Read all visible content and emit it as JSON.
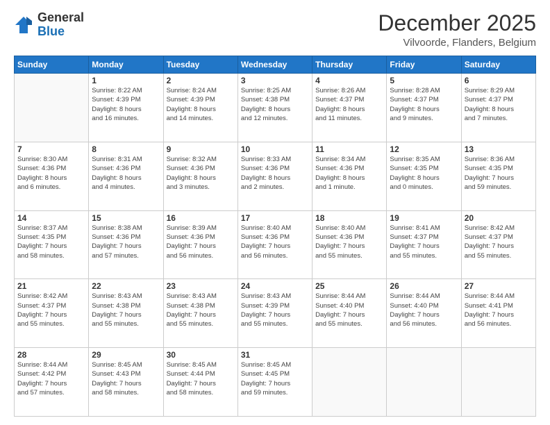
{
  "header": {
    "logo": {
      "line1": "General",
      "line2": "Blue"
    },
    "title": "December 2025",
    "location": "Vilvoorde, Flanders, Belgium"
  },
  "weekdays": [
    "Sunday",
    "Monday",
    "Tuesday",
    "Wednesday",
    "Thursday",
    "Friday",
    "Saturday"
  ],
  "weeks": [
    [
      {
        "day": "",
        "info": ""
      },
      {
        "day": "1",
        "info": "Sunrise: 8:22 AM\nSunset: 4:39 PM\nDaylight: 8 hours\nand 16 minutes."
      },
      {
        "day": "2",
        "info": "Sunrise: 8:24 AM\nSunset: 4:39 PM\nDaylight: 8 hours\nand 14 minutes."
      },
      {
        "day": "3",
        "info": "Sunrise: 8:25 AM\nSunset: 4:38 PM\nDaylight: 8 hours\nand 12 minutes."
      },
      {
        "day": "4",
        "info": "Sunrise: 8:26 AM\nSunset: 4:37 PM\nDaylight: 8 hours\nand 11 minutes."
      },
      {
        "day": "5",
        "info": "Sunrise: 8:28 AM\nSunset: 4:37 PM\nDaylight: 8 hours\nand 9 minutes."
      },
      {
        "day": "6",
        "info": "Sunrise: 8:29 AM\nSunset: 4:37 PM\nDaylight: 8 hours\nand 7 minutes."
      }
    ],
    [
      {
        "day": "7",
        "info": "Sunrise: 8:30 AM\nSunset: 4:36 PM\nDaylight: 8 hours\nand 6 minutes."
      },
      {
        "day": "8",
        "info": "Sunrise: 8:31 AM\nSunset: 4:36 PM\nDaylight: 8 hours\nand 4 minutes."
      },
      {
        "day": "9",
        "info": "Sunrise: 8:32 AM\nSunset: 4:36 PM\nDaylight: 8 hours\nand 3 minutes."
      },
      {
        "day": "10",
        "info": "Sunrise: 8:33 AM\nSunset: 4:36 PM\nDaylight: 8 hours\nand 2 minutes."
      },
      {
        "day": "11",
        "info": "Sunrise: 8:34 AM\nSunset: 4:36 PM\nDaylight: 8 hours\nand 1 minute."
      },
      {
        "day": "12",
        "info": "Sunrise: 8:35 AM\nSunset: 4:35 PM\nDaylight: 8 hours\nand 0 minutes."
      },
      {
        "day": "13",
        "info": "Sunrise: 8:36 AM\nSunset: 4:35 PM\nDaylight: 7 hours\nand 59 minutes."
      }
    ],
    [
      {
        "day": "14",
        "info": "Sunrise: 8:37 AM\nSunset: 4:35 PM\nDaylight: 7 hours\nand 58 minutes."
      },
      {
        "day": "15",
        "info": "Sunrise: 8:38 AM\nSunset: 4:36 PM\nDaylight: 7 hours\nand 57 minutes."
      },
      {
        "day": "16",
        "info": "Sunrise: 8:39 AM\nSunset: 4:36 PM\nDaylight: 7 hours\nand 56 minutes."
      },
      {
        "day": "17",
        "info": "Sunrise: 8:40 AM\nSunset: 4:36 PM\nDaylight: 7 hours\nand 56 minutes."
      },
      {
        "day": "18",
        "info": "Sunrise: 8:40 AM\nSunset: 4:36 PM\nDaylight: 7 hours\nand 55 minutes."
      },
      {
        "day": "19",
        "info": "Sunrise: 8:41 AM\nSunset: 4:37 PM\nDaylight: 7 hours\nand 55 minutes."
      },
      {
        "day": "20",
        "info": "Sunrise: 8:42 AM\nSunset: 4:37 PM\nDaylight: 7 hours\nand 55 minutes."
      }
    ],
    [
      {
        "day": "21",
        "info": "Sunrise: 8:42 AM\nSunset: 4:37 PM\nDaylight: 7 hours\nand 55 minutes."
      },
      {
        "day": "22",
        "info": "Sunrise: 8:43 AM\nSunset: 4:38 PM\nDaylight: 7 hours\nand 55 minutes."
      },
      {
        "day": "23",
        "info": "Sunrise: 8:43 AM\nSunset: 4:38 PM\nDaylight: 7 hours\nand 55 minutes."
      },
      {
        "day": "24",
        "info": "Sunrise: 8:43 AM\nSunset: 4:39 PM\nDaylight: 7 hours\nand 55 minutes."
      },
      {
        "day": "25",
        "info": "Sunrise: 8:44 AM\nSunset: 4:40 PM\nDaylight: 7 hours\nand 55 minutes."
      },
      {
        "day": "26",
        "info": "Sunrise: 8:44 AM\nSunset: 4:40 PM\nDaylight: 7 hours\nand 56 minutes."
      },
      {
        "day": "27",
        "info": "Sunrise: 8:44 AM\nSunset: 4:41 PM\nDaylight: 7 hours\nand 56 minutes."
      }
    ],
    [
      {
        "day": "28",
        "info": "Sunrise: 8:44 AM\nSunset: 4:42 PM\nDaylight: 7 hours\nand 57 minutes."
      },
      {
        "day": "29",
        "info": "Sunrise: 8:45 AM\nSunset: 4:43 PM\nDaylight: 7 hours\nand 58 minutes."
      },
      {
        "day": "30",
        "info": "Sunrise: 8:45 AM\nSunset: 4:44 PM\nDaylight: 7 hours\nand 58 minutes."
      },
      {
        "day": "31",
        "info": "Sunrise: 8:45 AM\nSunset: 4:45 PM\nDaylight: 7 hours\nand 59 minutes."
      },
      {
        "day": "",
        "info": ""
      },
      {
        "day": "",
        "info": ""
      },
      {
        "day": "",
        "info": ""
      }
    ]
  ]
}
